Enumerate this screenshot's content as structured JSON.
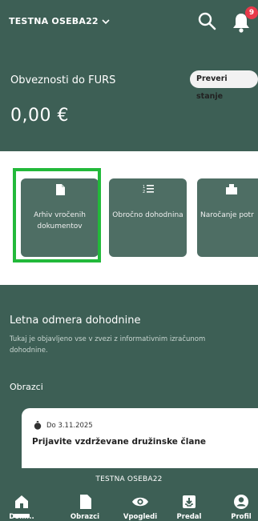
{
  "header": {
    "user_label": "TESTNA OSEBA22",
    "notification_count": "9",
    "colors": {
      "background": "#3d5f55",
      "badge": "#e8394a"
    }
  },
  "obveznosti": {
    "title": "Obveznosti do FURS",
    "button_label": "Preveri stanje",
    "amount": "0,00 €"
  },
  "tiles": [
    {
      "label": "Arhiv vročenih dokumentov",
      "icon": "document-icon"
    },
    {
      "label": "Obročno dohodnina",
      "icon": "list-icon"
    },
    {
      "label": "Naročanje potr",
      "icon": "folder-icon"
    }
  ],
  "letna": {
    "title": "Letna odmera dohodnine",
    "description": "Tukaj je objavljeno vse v zvezi z informativnim izračunom dohodnine."
  },
  "obrazci": {
    "heading": "Obrazci",
    "card": {
      "date": "Do 3.11.2025",
      "title": "Prijavite vzdrževane družinske člane"
    }
  },
  "bottom_nav": {
    "user_label": "TESTNA OSEBA22",
    "items": [
      {
        "label": "Dom...",
        "icon": "home-icon"
      },
      {
        "label": "Obrazci",
        "icon": "document-icon"
      },
      {
        "label": "Vpogledi",
        "icon": "eye-icon"
      },
      {
        "label": "Predal",
        "icon": "inbox-icon"
      },
      {
        "label": "Profil",
        "icon": "profile-icon"
      }
    ]
  }
}
